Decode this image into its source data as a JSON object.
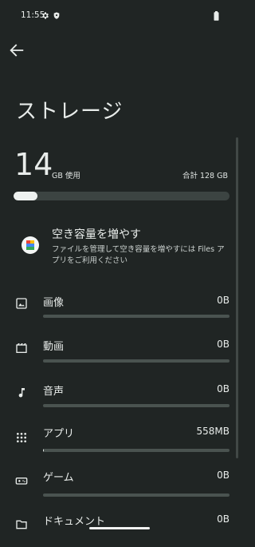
{
  "status_bar": {
    "time": "11:55"
  },
  "header": {
    "title": "ストレージ"
  },
  "usage": {
    "used_value": "14",
    "used_unit": "GB 使用",
    "total_label": "合計 128 GB",
    "used_fraction": 0.11
  },
  "free_up": {
    "title": "空き容量を増やす",
    "description": "ファイルを管理して空き容量を増やすには Files アプリをご利用ください"
  },
  "categories": [
    {
      "name": "images",
      "icon": "image-icon",
      "label": "画像",
      "size": "0B",
      "fraction": 0
    },
    {
      "name": "videos",
      "icon": "video-icon",
      "label": "動画",
      "size": "0B",
      "fraction": 0
    },
    {
      "name": "audio",
      "icon": "music-note-icon",
      "label": "音声",
      "size": "0B",
      "fraction": 0
    },
    {
      "name": "apps",
      "icon": "apps-grid-icon",
      "label": "アプリ",
      "size": "558MB",
      "fraction": 0.004
    },
    {
      "name": "games",
      "icon": "gamepad-icon",
      "label": "ゲーム",
      "size": "0B",
      "fraction": 0
    },
    {
      "name": "documents",
      "icon": "folder-icon",
      "label": "ドキュメント",
      "size": "0B",
      "fraction": 0
    }
  ],
  "colors": {
    "background": "#202524",
    "text": "#e8ecea",
    "track": "#3c4442",
    "fill": "#eef2f0"
  }
}
